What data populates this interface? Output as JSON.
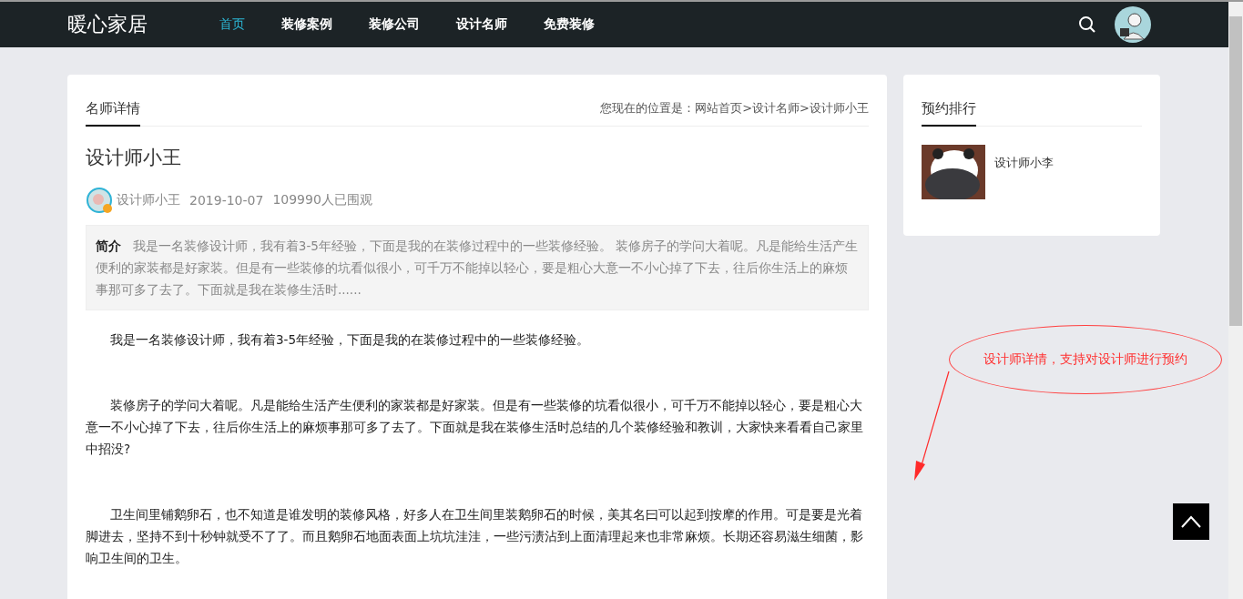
{
  "nav": {
    "logo": "暖心家居",
    "items": [
      {
        "label": "首页",
        "selected": true
      },
      {
        "label": "装修案例",
        "selected": false
      },
      {
        "label": "装修公司",
        "selected": false
      },
      {
        "label": "设计名师",
        "selected": false
      },
      {
        "label": "免费装修",
        "selected": false
      }
    ]
  },
  "main": {
    "tab": "名师详情",
    "breadcrumb": "您现在的位置是：网站首页>设计名师>设计师小王",
    "title": "设计师小王",
    "author": "设计师小王",
    "date": "2019-10-07",
    "views": "109990人已围观",
    "summary_label": "简介",
    "summary": "我是一名装修设计师，我有着3-5年经验，下面是我的在装修过程中的一些装修经验。 装修房子的学问大着呢。凡是能给生活产生便利的家装都是好家装。但是有一些装修的坑看似很小，可千万不能掉以轻心，要是粗心大意一不小心掉了下去，往后你生活上的麻烦事那可多了去了。下面就是我在装修生活时......",
    "paragraphs": [
      "我是一名装修设计师，我有着3-5年经验，下面是我的在装修过程中的一些装修经验。",
      "装修房子的学问大着呢。凡是能给生活产生便利的家装都是好家装。但是有一些装修的坑看似很小，可千万不能掉以轻心，要是粗心大意一不小心掉了下去，往后你生活上的麻烦事那可多了去了。下面就是我在装修生活时总结的几个装修经验和教训，大家快来看看自己家里中招没?",
      "卫生间里铺鹅卵石，也不知道是谁发明的装修风格，好多人在卫生间里装鹅卵石的时候，美其名曰可以起到按摩的作用。可是要是光着脚进去，坚持不到十秒钟就受不了了。而且鹅卵石地面表面上坑坑洼洼，一些污渍沾到上面清理起来也非常麻烦。长期还容易滋生细菌，影响卫生间的卫生。"
    ]
  },
  "sidebar": {
    "title": "预约排行",
    "items": [
      {
        "name": "设计师小李"
      }
    ]
  },
  "annotation": "设计师详情，支持对设计师进行预约"
}
